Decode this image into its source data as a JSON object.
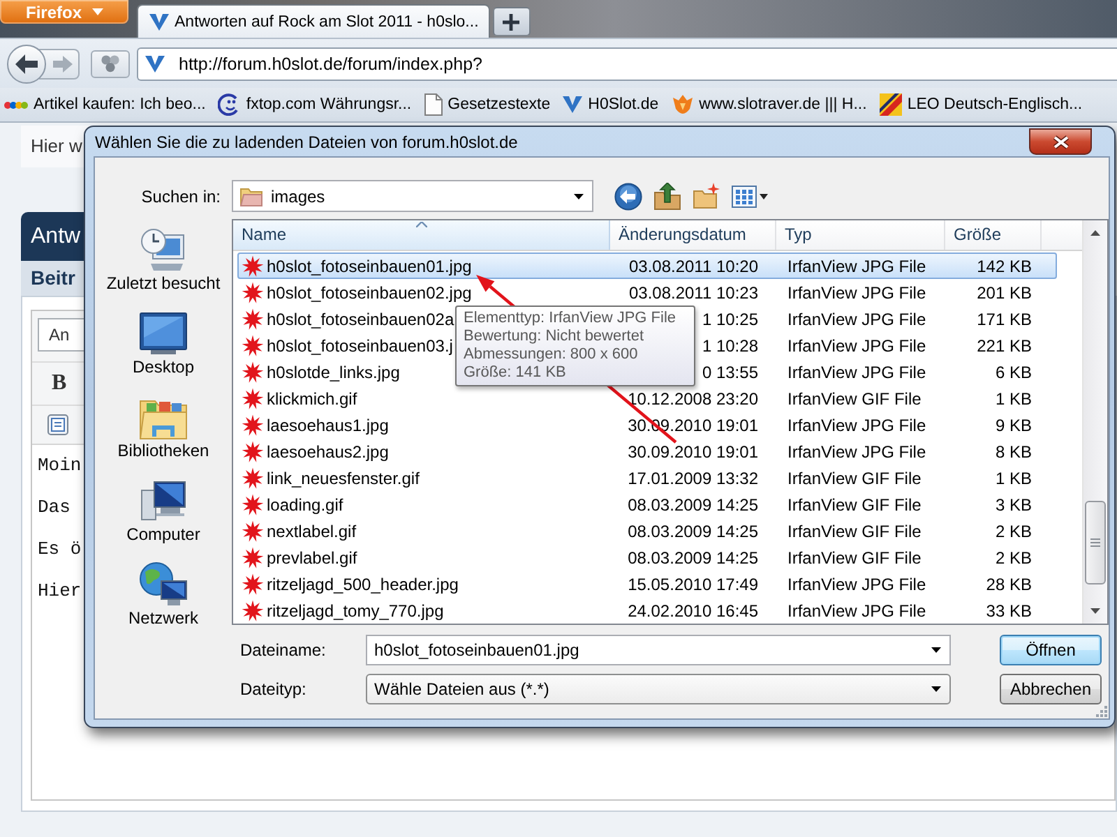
{
  "browser": {
    "app_menu": "Firefox",
    "tabs": [
      {
        "title": "Antworten auf Rock am Slot 2011 - h0slo...",
        "selected": true
      }
    ],
    "address": "http://forum.h0slot.de/forum/index.php?",
    "bookmarks": [
      {
        "label": "Artikel kaufen: Ich beo...",
        "kind": "dots"
      },
      {
        "label": "fxtop.com Währungsr...",
        "kind": "smiley"
      },
      {
        "label": "Gesetzestexte",
        "kind": "page"
      },
      {
        "label": "H0Slot.de",
        "kind": "vmark"
      },
      {
        "label": "www.slotraver.de ||| H...",
        "kind": "flame"
      },
      {
        "label": "LEO Deutsch-Englisch...",
        "kind": "leo"
      }
    ]
  },
  "page": {
    "notice": "Hier w",
    "heading": "Antw",
    "subheading": "Beitr",
    "format_select": "An",
    "bold_button": "B",
    "message_lines": [
      "Moin",
      "Das",
      "Es ö",
      "Hier"
    ]
  },
  "dialog": {
    "title": "Wählen Sie die zu ladenden Dateien von forum.h0slot.de",
    "look_in": {
      "label": "Suchen in:",
      "value": "images"
    },
    "places": [
      {
        "label": "Zuletzt besucht",
        "kind": "recent"
      },
      {
        "label": "Desktop",
        "kind": "desktop"
      },
      {
        "label": "Bibliotheken",
        "kind": "libraries"
      },
      {
        "label": "Computer",
        "kind": "computer"
      },
      {
        "label": "Netzwerk",
        "kind": "network"
      }
    ],
    "columns": [
      {
        "label": "Name",
        "sorted": true
      },
      {
        "label": "Änderungsdatum",
        "sorted": false
      },
      {
        "label": "Typ",
        "sorted": false
      },
      {
        "label": "Größe",
        "sorted": false
      }
    ],
    "files": [
      {
        "name": "h0slot_fotoseinbauen01.jpg",
        "date": "03.08.2011 10:20",
        "type": "IrfanView JPG File",
        "size": "142 KB",
        "selected": true
      },
      {
        "name": "h0slot_fotoseinbauen02.jpg",
        "date": "03.08.2011 10:23",
        "type": "IrfanView JPG File",
        "size": "201 KB",
        "selected": false
      },
      {
        "name": "h0slot_fotoseinbauen02a",
        "date": "1 10:25",
        "type": "IrfanView JPG File",
        "size": "171 KB",
        "selected": false
      },
      {
        "name": "h0slot_fotoseinbauen03.j",
        "date": "1 10:28",
        "type": "IrfanView JPG File",
        "size": "221 KB",
        "selected": false
      },
      {
        "name": "h0slotde_links.jpg",
        "date": "0 13:55",
        "type": "IrfanView JPG File",
        "size": "6 KB",
        "selected": false
      },
      {
        "name": "klickmich.gif",
        "date": "10.12.2008 23:20",
        "type": "IrfanView GIF File",
        "size": "1 KB",
        "selected": false
      },
      {
        "name": "laesoehaus1.jpg",
        "date": "30.09.2010 19:01",
        "type": "IrfanView JPG File",
        "size": "9 KB",
        "selected": false
      },
      {
        "name": "laesoehaus2.jpg",
        "date": "30.09.2010 19:01",
        "type": "IrfanView JPG File",
        "size": "8 KB",
        "selected": false
      },
      {
        "name": "link_neuesfenster.gif",
        "date": "17.01.2009 13:32",
        "type": "IrfanView GIF File",
        "size": "1 KB",
        "selected": false
      },
      {
        "name": "loading.gif",
        "date": "08.03.2009 14:25",
        "type": "IrfanView GIF File",
        "size": "3 KB",
        "selected": false
      },
      {
        "name": "nextlabel.gif",
        "date": "08.03.2009 14:25",
        "type": "IrfanView GIF File",
        "size": "2 KB",
        "selected": false
      },
      {
        "name": "prevlabel.gif",
        "date": "08.03.2009 14:25",
        "type": "IrfanView GIF File",
        "size": "2 KB",
        "selected": false
      },
      {
        "name": "ritzeljagd_500_header.jpg",
        "date": "15.05.2010 17:49",
        "type": "IrfanView JPG File",
        "size": "28 KB",
        "selected": false
      },
      {
        "name": "ritzeljagd_tomy_770.jpg",
        "date": "24.02.2010 16:45",
        "type": "IrfanView JPG File",
        "size": "33 KB",
        "selected": false
      }
    ],
    "tooltip": [
      "Elementtyp: IrfanView JPG File",
      "Bewertung: Nicht bewertet",
      "Abmessungen: 800 x 600",
      "Größe: 141 KB"
    ],
    "file_name": {
      "label": "Dateiname:",
      "value": "h0slot_fotoseinbauen01.jpg"
    },
    "file_type": {
      "label": "Dateityp:",
      "value": "Wähle Dateien aus (*.*)"
    },
    "buttons": [
      {
        "label": "Öffnen",
        "default": true
      },
      {
        "label": "Abbrechen",
        "default": false
      }
    ]
  }
}
